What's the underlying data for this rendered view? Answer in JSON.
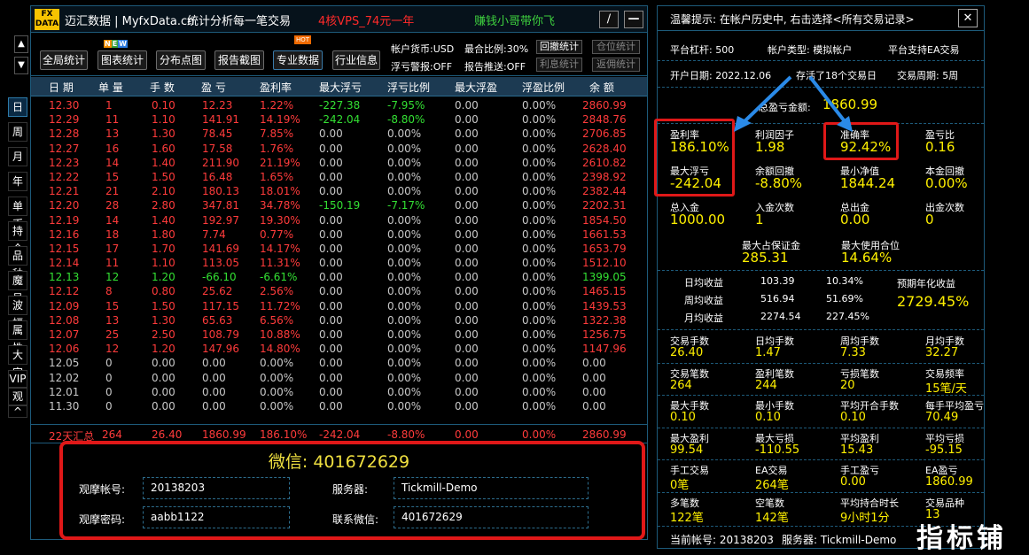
{
  "window": {
    "logo": "FX DATA",
    "title": "迈汇数据 | MyfxData.cn",
    "subtitle": "统计分析每一笔交易",
    "promo1": "4核VPS_74元一年",
    "promo2": "赚钱小哥带你飞",
    "min_btn": "∕",
    "close_btn": "—"
  },
  "toolbar": {
    "buttons": [
      "全局统计",
      "图表统计",
      "分布点图",
      "报告截图",
      "专业数据",
      "行业信息"
    ],
    "new_badge": [
      "N",
      "E",
      "W"
    ],
    "hot_badge": "HOT",
    "info": [
      "帐户货币:USD",
      "最合比例:30%",
      "浮亏警报:OFF",
      "报告推送:OFF"
    ],
    "small_buttons": [
      "回撤统计",
      "仓位统计",
      "利息统计",
      "返佣统计"
    ]
  },
  "side_nav": [
    "日",
    "周",
    "月",
    "年",
    "单币",
    "持仓",
    "品种",
    "魔号",
    "波幅",
    "属性",
    "大字",
    "VIP",
    "观摩",
    "^"
  ],
  "table": {
    "headers": [
      "日 期",
      "单 量",
      "手 数",
      "盈 亏",
      "盈利率",
      "最大浮亏",
      "浮亏比例",
      "最大浮盈",
      "浮盈比例",
      "余 额"
    ],
    "rows": [
      [
        "12.30",
        "1",
        "0.10",
        "12.23",
        "1.22%",
        "-227.38",
        "-7.95%",
        "0.00",
        "0.00%",
        "2860.99",
        "red",
        "grn"
      ],
      [
        "12.29",
        "11",
        "1.10",
        "141.91",
        "14.19%",
        "-242.04",
        "-8.80%",
        "0.00",
        "0.00%",
        "2848.76",
        "red",
        "grn"
      ],
      [
        "12.28",
        "13",
        "1.30",
        "78.45",
        "7.85%",
        "0.00",
        "0.00%",
        "0.00",
        "0.00%",
        "2706.85",
        "red",
        "gry"
      ],
      [
        "12.27",
        "16",
        "1.60",
        "17.58",
        "1.76%",
        "0.00",
        "0.00%",
        "0.00",
        "0.00%",
        "2628.40",
        "red",
        "gry"
      ],
      [
        "12.23",
        "14",
        "1.40",
        "211.90",
        "21.19%",
        "0.00",
        "0.00%",
        "0.00",
        "0.00%",
        "2610.82",
        "red",
        "gry"
      ],
      [
        "12.22",
        "15",
        "1.50",
        "16.48",
        "1.65%",
        "0.00",
        "0.00%",
        "0.00",
        "0.00%",
        "2398.92",
        "red",
        "gry"
      ],
      [
        "12.21",
        "21",
        "2.10",
        "180.13",
        "18.01%",
        "0.00",
        "0.00%",
        "0.00",
        "0.00%",
        "2382.44",
        "red",
        "gry"
      ],
      [
        "12.20",
        "28",
        "2.80",
        "347.81",
        "34.78%",
        "-150.19",
        "-7.17%",
        "0.00",
        "0.00%",
        "2202.31",
        "red",
        "grn"
      ],
      [
        "12.19",
        "14",
        "1.40",
        "192.97",
        "19.30%",
        "0.00",
        "0.00%",
        "0.00",
        "0.00%",
        "1854.50",
        "red",
        "gry"
      ],
      [
        "12.16",
        "18",
        "1.80",
        "7.74",
        "0.77%",
        "0.00",
        "0.00%",
        "0.00",
        "0.00%",
        "1661.53",
        "red",
        "gry"
      ],
      [
        "12.15",
        "17",
        "1.70",
        "141.69",
        "14.17%",
        "0.00",
        "0.00%",
        "0.00",
        "0.00%",
        "1653.79",
        "red",
        "gry"
      ],
      [
        "12.14",
        "11",
        "1.10",
        "113.05",
        "11.31%",
        "0.00",
        "0.00%",
        "0.00",
        "0.00%",
        "1512.10",
        "red",
        "gry"
      ],
      [
        "12.13",
        "12",
        "1.20",
        "-66.10",
        "-6.61%",
        "0.00",
        "0.00%",
        "0.00",
        "0.00%",
        "1399.05",
        "grn",
        "gry"
      ],
      [
        "12.12",
        "8",
        "0.80",
        "25.62",
        "2.56%",
        "0.00",
        "0.00%",
        "0.00",
        "0.00%",
        "1465.15",
        "red",
        "gry"
      ],
      [
        "12.09",
        "15",
        "1.50",
        "117.15",
        "11.72%",
        "0.00",
        "0.00%",
        "0.00",
        "0.00%",
        "1439.53",
        "red",
        "gry"
      ],
      [
        "12.08",
        "13",
        "1.30",
        "65.63",
        "6.56%",
        "0.00",
        "0.00%",
        "0.00",
        "0.00%",
        "1322.38",
        "red",
        "gry"
      ],
      [
        "12.07",
        "25",
        "2.50",
        "108.79",
        "10.88%",
        "0.00",
        "0.00%",
        "0.00",
        "0.00%",
        "1256.75",
        "red",
        "gry"
      ],
      [
        "12.06",
        "12",
        "1.20",
        "147.96",
        "14.80%",
        "0.00",
        "0.00%",
        "0.00",
        "0.00%",
        "1147.96",
        "red",
        "gry"
      ],
      [
        "12.05",
        "0",
        "0.00",
        "0.00",
        "0.00%",
        "0.00",
        "0.00%",
        "0.00",
        "0.00%",
        "0.00",
        "gry",
        "gry"
      ],
      [
        "12.02",
        "0",
        "0.00",
        "0.00",
        "0.00%",
        "0.00",
        "0.00%",
        "0.00",
        "0.00%",
        "0.00",
        "gry",
        "gry"
      ],
      [
        "12.01",
        "0",
        "0.00",
        "0.00",
        "0.00%",
        "0.00",
        "0.00%",
        "0.00",
        "0.00%",
        "0.00",
        "gry",
        "gry"
      ],
      [
        "11.30",
        "0",
        "0.00",
        "0.00",
        "0.00%",
        "0.00",
        "0.00%",
        "0.00",
        "0.00%",
        "0.00",
        "gry",
        "gry"
      ]
    ],
    "summary": [
      "22天汇总",
      "264",
      "26.40",
      "1860.99",
      "186.10%",
      "-242.04",
      "-8.80%",
      "0.00",
      "0.00%",
      "2860.99"
    ]
  },
  "account": {
    "wechat_title": "微信: 401672629",
    "account_label": "观摩帐号:",
    "account_value": "20138203",
    "server_label": "服务器:",
    "server_value": "Tickmill-Demo",
    "password_label": "观摩密码:",
    "password_value": "aabb1122",
    "contact_label": "联系微信:",
    "contact_value": "401672629"
  },
  "panel": {
    "tip": "温馨提示: 在帐户历史中, 右击选择<所有交易记录>",
    "close": "✕",
    "leverage": "平台杠杆: 500",
    "account_type": "帐户类型: 模拟帐户",
    "ea": "平台支持EA交易",
    "open_date": "开户日期: 2022.12.06",
    "survived": "存活了18个交易日",
    "cycle": "交易周期: 5周",
    "total_profit_label": "总盈亏金额:",
    "total_profit": "1860.99",
    "stats": [
      {
        "label": "盈利率",
        "value": "186.10%"
      },
      {
        "label": "利润因子",
        "value": "1.98"
      },
      {
        "label": "准确率",
        "value": "92.42%"
      },
      {
        "label": "盈亏比",
        "value": "0.16"
      },
      {
        "label": "最大浮亏",
        "value": "-242.04"
      },
      {
        "label": "余额回撤",
        "value": "-8.80%"
      },
      {
        "label": "最小净值",
        "value": "1844.24"
      },
      {
        "label": "本金回撤",
        "value": "0.00%"
      },
      {
        "label": "总入金",
        "value": "1000.00"
      },
      {
        "label": "入金次数",
        "value": "1"
      },
      {
        "label": "总出金",
        "value": "0.00"
      },
      {
        "label": "出金次数",
        "value": "0"
      }
    ],
    "margin_label": "最大占保证金",
    "margin_value": "285.31",
    "position_label": "最大使用合位",
    "position_value": "14.64%",
    "income": [
      {
        "label": "日均收益",
        "value": "103.39",
        "pct": "10.34%"
      },
      {
        "label": "周均收益",
        "value": "516.94",
        "pct": "51.69%"
      },
      {
        "label": "月均收益",
        "value": "2274.54",
        "pct": "227.45%"
      }
    ],
    "annual_label": "预期年化收益",
    "annual_value": "2729.45%",
    "grid": [
      {
        "label": "交易手数",
        "value": "26.40"
      },
      {
        "label": "日均手数",
        "value": "1.47"
      },
      {
        "label": "周均手数",
        "value": "7.33"
      },
      {
        "label": "月均手数",
        "value": "32.27"
      },
      {
        "label": "交易笔数",
        "value": "264"
      },
      {
        "label": "盈利笔数",
        "value": "244"
      },
      {
        "label": "亏损笔数",
        "value": "20"
      },
      {
        "label": "交易频率",
        "value": "15笔/天"
      },
      {
        "label": "最大手数",
        "value": "0.10"
      },
      {
        "label": "最小手数",
        "value": "0.10"
      },
      {
        "label": "平均开合手数",
        "value": "0.10"
      },
      {
        "label": "每手平均盈亏",
        "value": "70.49"
      },
      {
        "label": "最大盈利",
        "value": "99.54"
      },
      {
        "label": "最大亏损",
        "value": "-110.55"
      },
      {
        "label": "平均盈利",
        "value": "15.43"
      },
      {
        "label": "平均亏损",
        "value": "-95.15"
      },
      {
        "label": "手工交易",
        "value": "0笔"
      },
      {
        "label": "EA交易",
        "value": "264笔"
      },
      {
        "label": "手工盈亏",
        "value": "0.00"
      },
      {
        "label": "EA盈亏",
        "value": "1860.99"
      },
      {
        "label": "多笔数",
        "value": "122笔"
      },
      {
        "label": "空笔数",
        "value": "142笔"
      },
      {
        "label": "平均持合时长",
        "value": "9小时1分"
      },
      {
        "label": "交易品种",
        "value": "13"
      }
    ],
    "footer_account": "当前帐号: 20138203",
    "footer_server": "服务器: Tickmill-Demo"
  },
  "watermark": "指标铺",
  "colors": {
    "profit": "#ff3b3b",
    "loss": "#33e033",
    "value": "#fff000",
    "accent": "#e01818",
    "border": "#1d5a7a"
  }
}
